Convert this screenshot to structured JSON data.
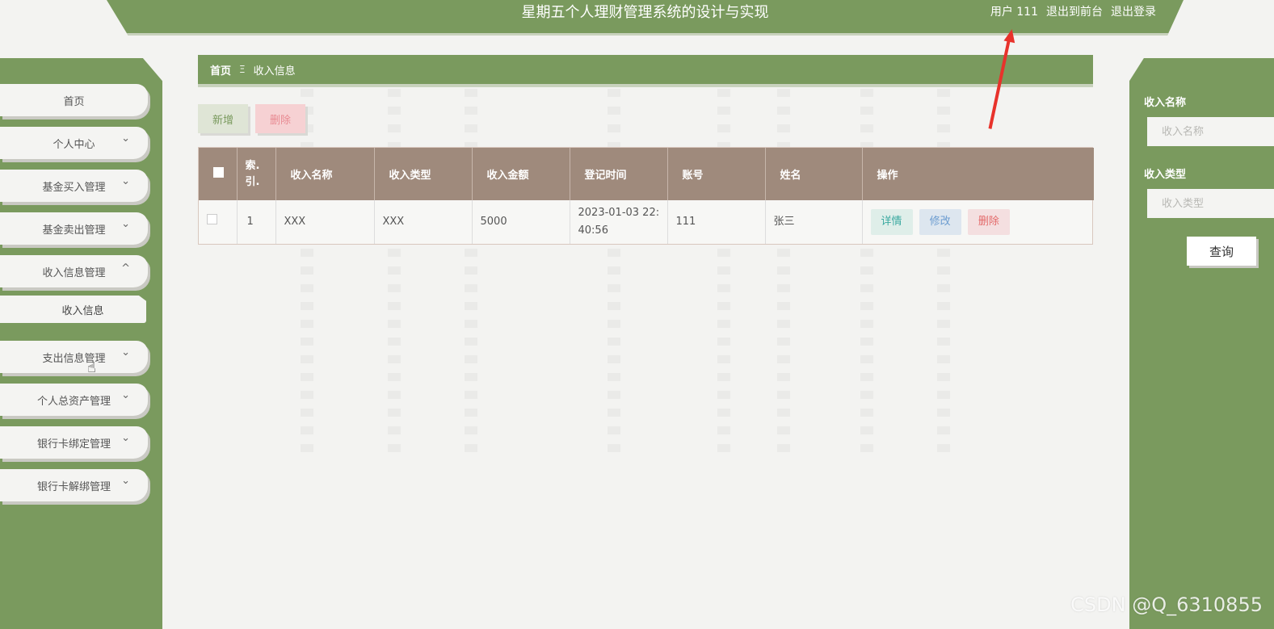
{
  "header": {
    "title": "星期五个人理财管理系统的设计与实现",
    "user_label": "用户 111",
    "to_front_label": "退出到前台",
    "logout_label": "退出登录"
  },
  "sidebar": {
    "items": [
      {
        "label": "首页",
        "expandable": false
      },
      {
        "label": "个人中心",
        "expandable": true
      },
      {
        "label": "基金买入管理",
        "expandable": true
      },
      {
        "label": "基金卖出管理",
        "expandable": true
      },
      {
        "label": "收入信息管理",
        "expandable": true,
        "expanded": true
      },
      {
        "label": "收入信息",
        "sub": true
      },
      {
        "label": "支出信息管理",
        "expandable": true
      },
      {
        "label": "个人总资产管理",
        "expandable": true
      },
      {
        "label": "银行卡绑定管理",
        "expandable": true
      },
      {
        "label": "银行卡解绑管理",
        "expandable": true
      }
    ],
    "chevron_down": "⌄",
    "chevron_up": "^"
  },
  "breadcrumb": {
    "home": "首页",
    "separator": "Ξ",
    "current": "收入信息"
  },
  "toolbar": {
    "add_label": "新增",
    "delete_label": "删除"
  },
  "table": {
    "columns": [
      "索引",
      "收入名称",
      "收入类型",
      "收入金额",
      "登记时间",
      "账号",
      "姓名",
      "操作"
    ],
    "index_header_lines": [
      "索.",
      "引."
    ],
    "rows": [
      {
        "index": "1",
        "name": "XXX",
        "type": "XXX",
        "amount": "5000",
        "time": "2023-01-03 22:40:56",
        "account": "111",
        "person": "张三"
      }
    ],
    "actions": {
      "detail": "详情",
      "edit": "修改",
      "remove": "删除"
    }
  },
  "search": {
    "name_label": "收入名称",
    "name_placeholder": "收入名称",
    "type_label": "收入类型",
    "type_placeholder": "收入类型",
    "query_label": "查询"
  },
  "watermark": "CSDN @Q_6310855",
  "colors": {
    "primary": "#7a9a5e",
    "table_header": "#9f8a7c",
    "annotation_arrow": "#e8322b"
  }
}
